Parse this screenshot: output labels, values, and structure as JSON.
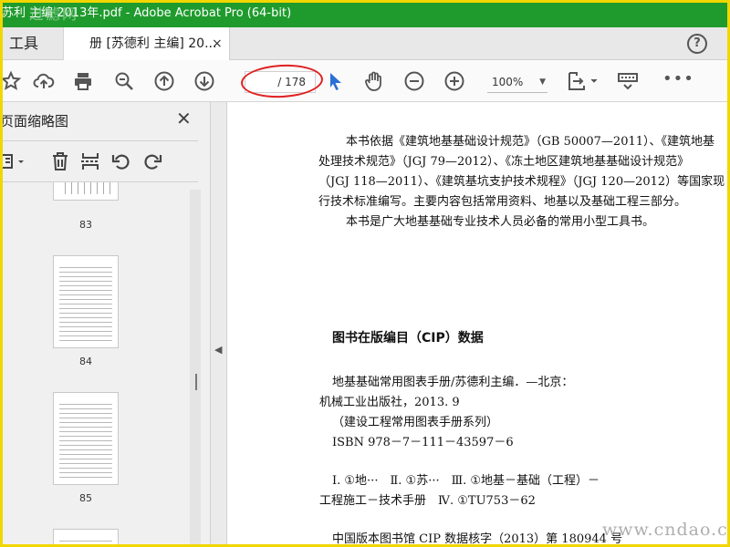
{
  "window": {
    "title": "苏利 主编 2013年.pdf - Adobe Acrobat Pro (64-bit)",
    "watermark_top": "过滤网"
  },
  "tabs": {
    "tools_label": "工具",
    "doc_label": "册 [苏德利 主编] 20...",
    "close": "×",
    "help": "?"
  },
  "toolbar": {
    "page_field": "/ 178",
    "zoom_value": "100%",
    "icons": [
      "star-icon",
      "cloud-upload-icon",
      "print-icon",
      "zoom-search-icon",
      "page-up-icon",
      "page-down-icon",
      "cursor-icon",
      "hand-icon",
      "zoom-out-icon",
      "zoom-in-icon",
      "page-fit-icon",
      "keyboard-icon",
      "more-icon"
    ]
  },
  "sidebar": {
    "title": "页面缩略图",
    "close": "✕",
    "thumbnails": [
      {
        "page": "83"
      },
      {
        "page": "84"
      },
      {
        "page": "85"
      }
    ]
  },
  "document": {
    "intro": [
      "本书依据《建筑地基基础设计规范》（GB 50007—2011）、《建筑地基",
      "处理技术规范》（JGJ 79—2012）、《冻土地区建筑地基基础设计规范》",
      "（JGJ 118—2011）、《建筑基坑支护技术规程》（JGJ 120—2012）等国家现",
      "行技术标准编写。主要内容包括常用资料、地基以及基础工程三部分。",
      "本书是广大地基基础专业技术人员必备的常用小型工具书。"
    ],
    "cip_title": "图书在版编目（CIP）数据",
    "cip_lines": [
      "地基基础常用图表手册/苏德利主编．—北京：",
      "机械工业出版社，2013. 9",
      "（建设工程常用图表手册系列）",
      "ISBN 978－7－111－43597－6",
      "Ⅰ. ①地···　Ⅱ. ①苏···　Ⅲ. ①地基－基础（工程）－",
      "工程施工－技术手册　Ⅳ. ①TU753－62",
      "中国版本图书馆 CIP 数据核字（2013）第 180944 号"
    ]
  },
  "watermark_bottom": "www.cndao.com"
}
